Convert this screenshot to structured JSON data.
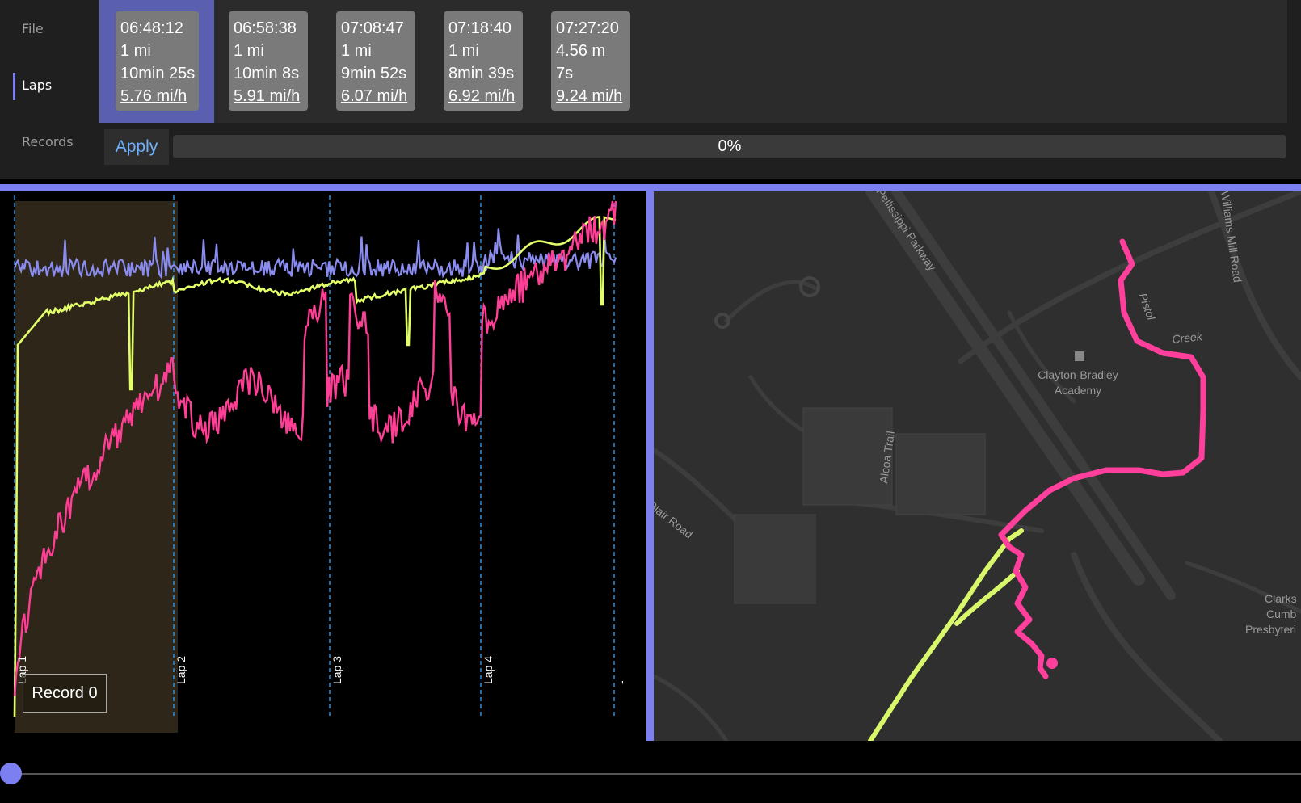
{
  "nav": {
    "items": [
      {
        "label": "File",
        "active": false
      },
      {
        "label": "Laps",
        "active": true
      },
      {
        "label": "Records",
        "active": false
      }
    ]
  },
  "laps": [
    {
      "time": "06:48:12",
      "distance": "1 mi",
      "duration": "10min 25s",
      "speed": "5.76 mi/h",
      "selected": true
    },
    {
      "time": "06:58:38",
      "distance": "1 mi",
      "duration": "10min 8s",
      "speed": "5.91 mi/h",
      "selected": false
    },
    {
      "time": "07:08:47",
      "distance": "1 mi",
      "duration": "9min 52s",
      "speed": "6.07 mi/h",
      "selected": false
    },
    {
      "time": "07:18:40",
      "distance": "1 mi",
      "duration": "8min 39s",
      "speed": "6.92 mi/h",
      "selected": false
    },
    {
      "time": "07:27:20",
      "distance": "4.56 m",
      "duration": "7s",
      "speed": "9.24 mi/h",
      "selected": false
    }
  ],
  "toolbar": {
    "apply_label": "Apply",
    "progress_text": "0%",
    "progress_value": 0
  },
  "chart": {
    "lap_labels": [
      "Lap 1",
      "Lap 2",
      "Lap 3",
      "Lap 4",
      "-"
    ],
    "tooltip": "Record 0",
    "colors": {
      "series_blue": "#8a8cf0",
      "series_yellow": "#e2ff6a",
      "series_pink": "#ff3f95",
      "lap_line": "#2f8fe0",
      "selection": "#2e2618"
    }
  },
  "map": {
    "labels": [
      {
        "text": "Pellissippi Parkway"
      },
      {
        "text": "Alcoa Trail"
      },
      {
        "text": "Williams Mill Road"
      },
      {
        "text": "Pistol"
      },
      {
        "text": "Creek"
      },
      {
        "text": "Clayton-Bradley"
      },
      {
        "text": "Academy"
      },
      {
        "text": "Blair Road"
      },
      {
        "text": "Clarks"
      },
      {
        "text": "Cumb"
      },
      {
        "text": "Presbyteri"
      }
    ],
    "colors": {
      "track_pink": "#ff3f9c",
      "track_yellow": "#d8f76a",
      "road": "#3c3c3c",
      "bg": "#2f2f2f"
    }
  },
  "slider": {
    "position": 0
  }
}
